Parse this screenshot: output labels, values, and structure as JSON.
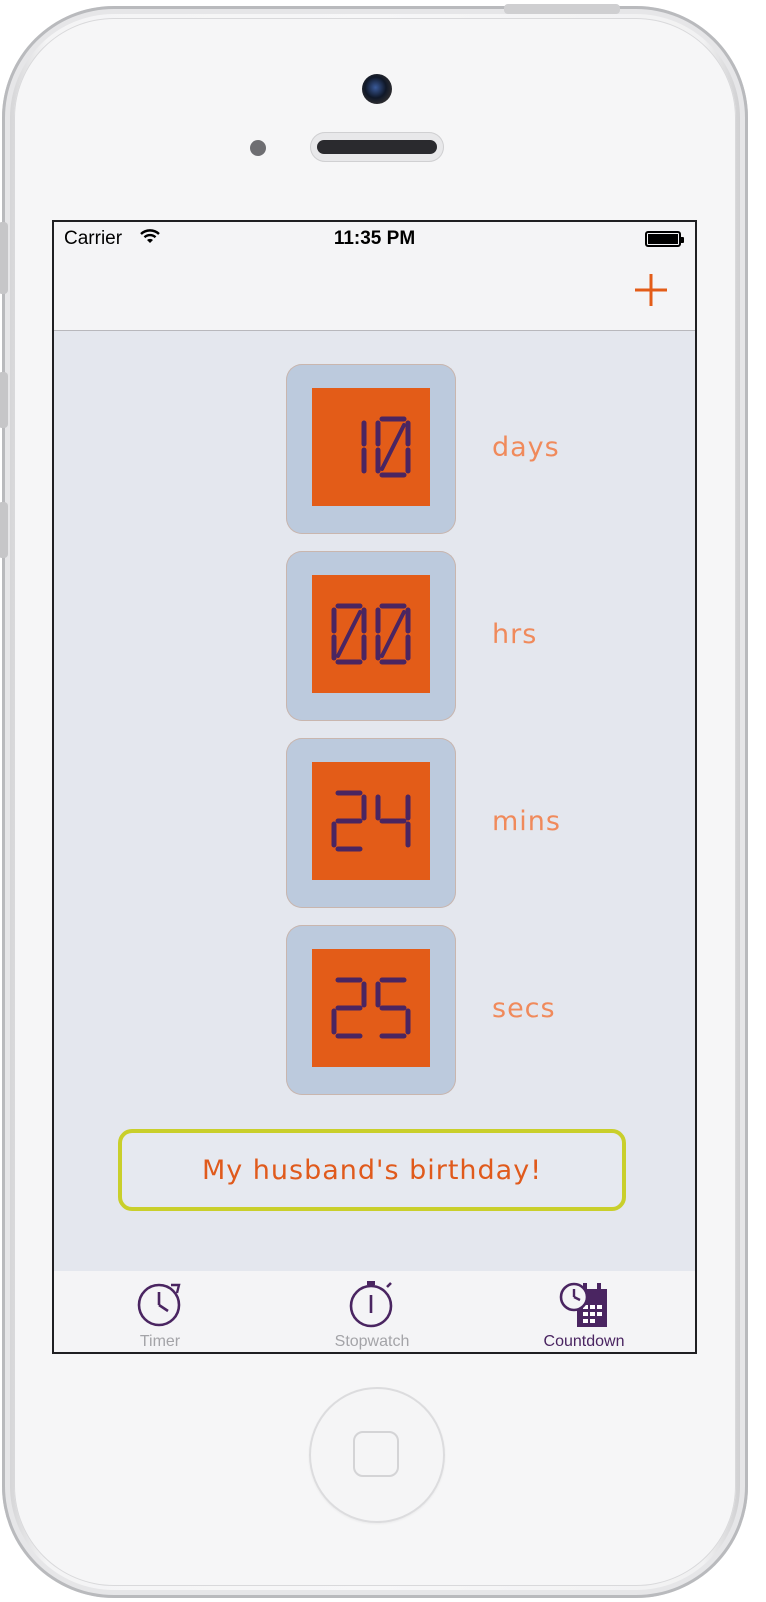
{
  "status_bar": {
    "carrier": "Carrier",
    "time": "11:35 PM"
  },
  "nav": {
    "add_icon": "plus-icon"
  },
  "countdown": [
    {
      "value": "10",
      "unit": "days"
    },
    {
      "value": "00",
      "unit": "hrs"
    },
    {
      "value": "24",
      "unit": "mins"
    },
    {
      "value": "25",
      "unit": "secs"
    }
  ],
  "event": {
    "title": "My husband's birthday!"
  },
  "tabs": [
    {
      "label": "Timer",
      "icon": "clock-refresh-icon",
      "active": false
    },
    {
      "label": "Stopwatch",
      "icon": "stopwatch-icon",
      "active": false
    },
    {
      "label": "Countdown",
      "icon": "calendar-clock-icon",
      "active": true
    }
  ],
  "colors": {
    "accent": "#e35c18",
    "tab_active": "#4a2561",
    "tab_inactive_label": "#a4a4a8",
    "digit": "#4a2561",
    "note_border": "#c9cf2b"
  }
}
